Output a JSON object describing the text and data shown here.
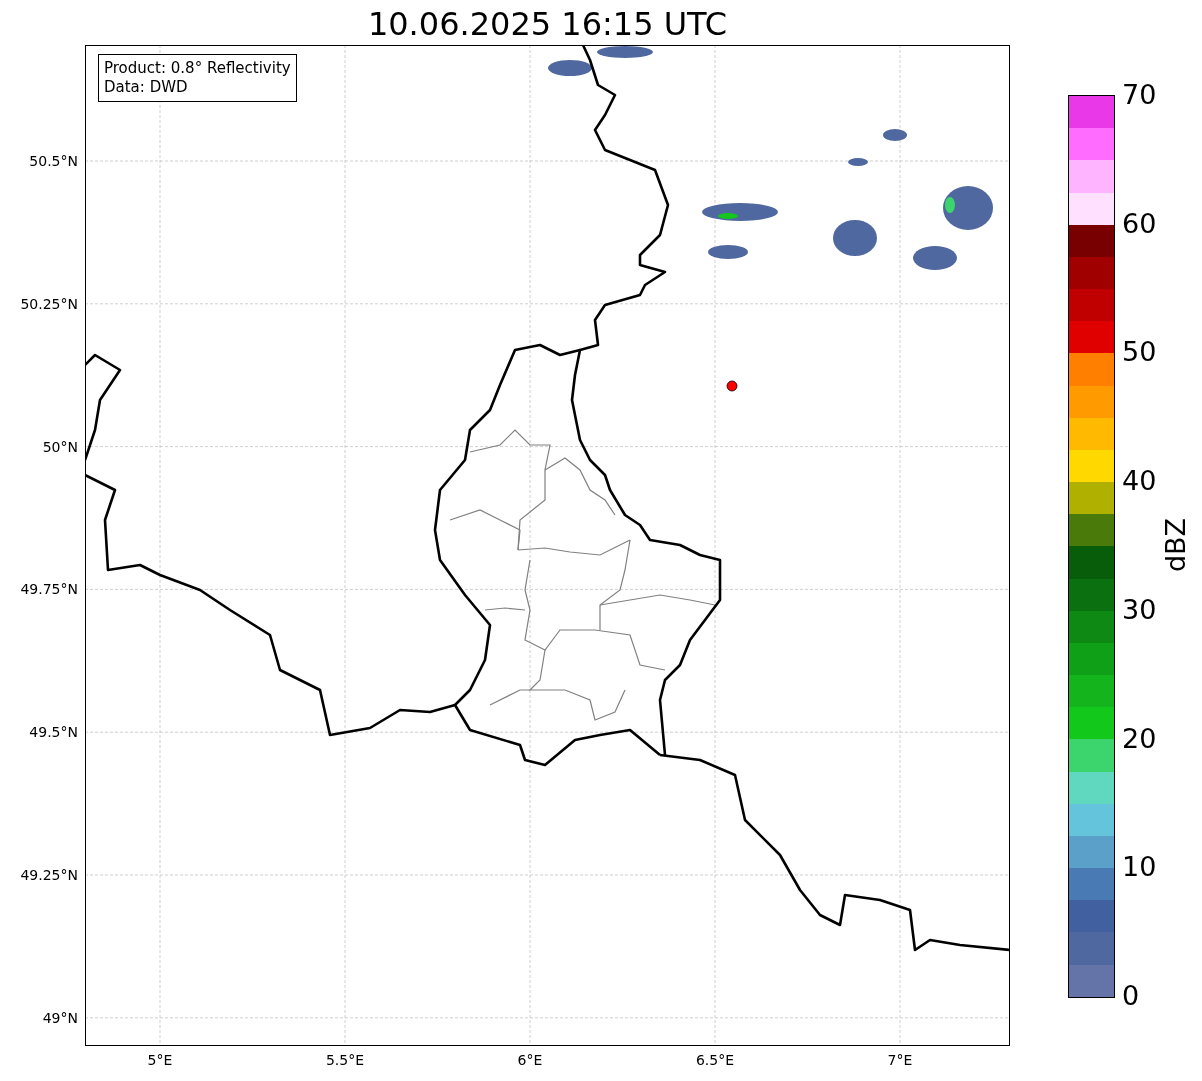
{
  "title": "10.06.2025 16:15 UTC",
  "info_box": [
    "Product: 0.8° Reflectivity",
    "Data: DWD"
  ],
  "y_ticks": [
    "50.5°N",
    "50.25°N",
    "50°N",
    "49.75°N",
    "49.5°N",
    "49.25°N",
    "49°N"
  ],
  "x_ticks": [
    "5°E",
    "5.5°E",
    "6°E",
    "6.5°E",
    "7°E"
  ],
  "colorbar": {
    "label": "dBZ",
    "ticks": [
      "70",
      "60",
      "50",
      "40",
      "30",
      "20",
      "10",
      "0"
    ],
    "bins": [
      {
        "color": "#e838e8"
      },
      {
        "color": "#ff6cff"
      },
      {
        "color": "#ffb4ff"
      },
      {
        "color": "#ffe0ff"
      },
      {
        "color": "#780000"
      },
      {
        "color": "#a00000"
      },
      {
        "color": "#c00000"
      },
      {
        "color": "#e00000"
      },
      {
        "color": "#ff7f00"
      },
      {
        "color": "#ff9b00"
      },
      {
        "color": "#ffba00"
      },
      {
        "color": "#ffd800"
      },
      {
        "color": "#b0b000"
      },
      {
        "color": "#4a7a0a"
      },
      {
        "color": "#075d0a"
      },
      {
        "color": "#0a7010"
      },
      {
        "color": "#0e8a14"
      },
      {
        "color": "#10a018"
      },
      {
        "color": "#14b41c"
      },
      {
        "color": "#12c81a"
      },
      {
        "color": "#3cd46c"
      },
      {
        "color": "#60d8c0"
      },
      {
        "color": "#64c4dc"
      },
      {
        "color": "#5aa0c8"
      },
      {
        "color": "#4a7ab4"
      },
      {
        "color": "#4060a0"
      },
      {
        "color": "#5068a0"
      },
      {
        "color": "#6474a8"
      }
    ]
  }
}
